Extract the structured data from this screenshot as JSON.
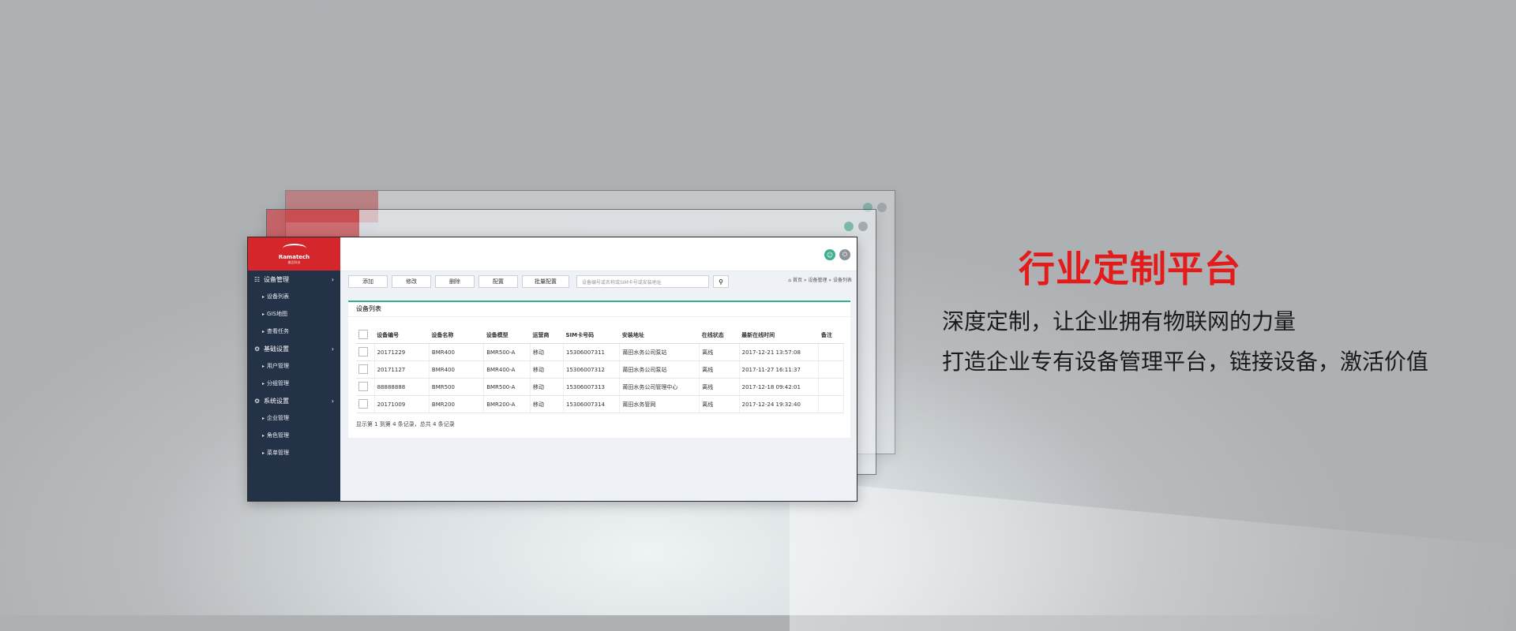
{
  "app": {
    "logo_text": "Ramatech",
    "logo_sub": "睿迈科技"
  },
  "sidebar": {
    "groups": [
      {
        "label": "设备管理",
        "items": [
          "设备列表",
          "GIS地图",
          "查看任务"
        ]
      },
      {
        "label": "基础设置",
        "items": [
          "用户管理",
          "分组管理"
        ]
      },
      {
        "label": "系统设置",
        "items": [
          "企业管理",
          "角色管理",
          "菜单管理"
        ]
      }
    ]
  },
  "toolbar": {
    "buttons": [
      "添加",
      "修改",
      "删除",
      "配置",
      "批量配置"
    ],
    "search_placeholder": "设备编号或名称或SIM卡号或安装地址"
  },
  "breadcrumb": "首页 » 设备管理 » 设备列表",
  "panel": {
    "title": "设备列表"
  },
  "table": {
    "headers": [
      "设备编号",
      "设备名称",
      "设备模型",
      "运营商",
      "SIM卡号码",
      "安装地址",
      "在线状态",
      "最新在线时间",
      "备注"
    ],
    "rows": [
      [
        "20171229",
        "BMR400",
        "BMR500-A",
        "移动",
        "15306007311",
        "莆田水务公司泵站",
        "离线",
        "2017-12-21 13:57:08",
        ""
      ],
      [
        "20171127",
        "BMR400",
        "BMR400-A",
        "移动",
        "15306007312",
        "莆田水务公司泵站",
        "离线",
        "2017-11-27 16:11:37",
        ""
      ],
      [
        "88888888",
        "BMR500",
        "BMR500-A",
        "移动",
        "15306007313",
        "莆田水务公司管理中心",
        "离线",
        "2017-12-18 09:42:01",
        ""
      ],
      [
        "20171009",
        "BMR200",
        "BMR200-A",
        "移动",
        "15306007314",
        "莆田水务管网",
        "离线",
        "2017-12-24 19:32:40",
        ""
      ]
    ],
    "footer": "显示第 1 到第 4 条记录，总共 4 条记录"
  },
  "promo": {
    "title": "行业定制平台",
    "line1": "深度定制，让企业拥有物联网的力量",
    "line2": "打造企业专有设备管理平台，链接设备，激活价值"
  }
}
